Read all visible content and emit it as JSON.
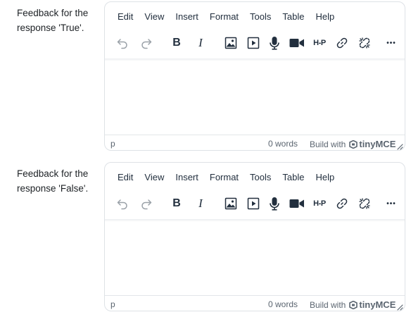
{
  "fields": [
    {
      "label": "Feedback for the response 'True'.",
      "menu": [
        "Edit",
        "View",
        "Insert",
        "Format",
        "Tools",
        "Table",
        "Help"
      ],
      "statusbar": {
        "path": "p",
        "word_count": "0 words",
        "branding_prefix": "Build with",
        "branding_name": "tinyMCE"
      }
    },
    {
      "label": "Feedback for the response 'False'.",
      "menu": [
        "Edit",
        "View",
        "Insert",
        "Format",
        "Tools",
        "Table",
        "Help"
      ],
      "statusbar": {
        "path": "p",
        "word_count": "0 words",
        "branding_prefix": "Build with",
        "branding_name": "tinyMCE"
      }
    }
  ],
  "toolbar_buttons": [
    {
      "name": "undo-button",
      "icon": "undo-icon",
      "enabled": false
    },
    {
      "name": "redo-button",
      "icon": "redo-icon",
      "enabled": false
    },
    {
      "name": "bold-button",
      "icon": "bold-icon",
      "text": "B"
    },
    {
      "name": "italic-button",
      "icon": "italic-icon",
      "text": "I"
    },
    {
      "name": "image-button",
      "icon": "image-icon"
    },
    {
      "name": "media-button",
      "icon": "media-play-icon"
    },
    {
      "name": "record-audio-button",
      "icon": "microphone-icon"
    },
    {
      "name": "record-video-button",
      "icon": "video-camera-icon"
    },
    {
      "name": "h5p-button",
      "icon": "h5p-icon",
      "text": "H-P"
    },
    {
      "name": "link-button",
      "icon": "link-icon"
    },
    {
      "name": "unlink-button",
      "icon": "unlink-icon"
    },
    {
      "name": "more-button",
      "icon": "more-icon",
      "text": "•••"
    }
  ],
  "colors": {
    "text": "#1d2125",
    "toolbar_icon": "#222f3e",
    "disabled_icon": "#9aa1a8",
    "border": "#dee2e6",
    "status_text": "#5b6570"
  }
}
